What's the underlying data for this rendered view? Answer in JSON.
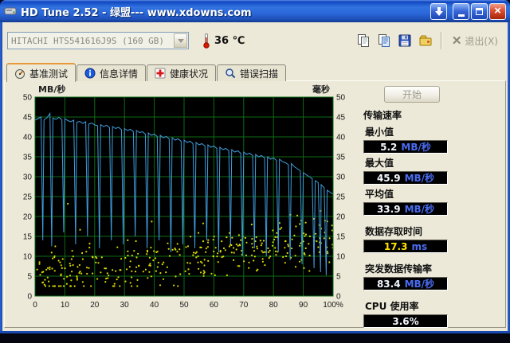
{
  "window": {
    "title": "HD Tune 2.52 - 绿盟--- www.xdowns.com"
  },
  "toolbar": {
    "drive_select": "HITACHI HTS541616J9S (160 GB)",
    "temperature": "36 ℃",
    "exit_label": "退出(X)"
  },
  "tabs": [
    {
      "label": "基准测试",
      "active": true
    },
    {
      "label": "信息详情",
      "active": false
    },
    {
      "label": "健康状况",
      "active": false
    },
    {
      "label": "错误扫描",
      "active": false
    }
  ],
  "controls": {
    "start_label": "开始"
  },
  "results": {
    "section_title": "传输速率",
    "rows": {
      "min": {
        "label": "最小值",
        "value": "5.2",
        "unit": "MB/秒"
      },
      "max": {
        "label": "最大值",
        "value": "45.9",
        "unit": "MB/秒"
      },
      "avg": {
        "label": "平均值",
        "value": "33.9",
        "unit": "MB/秒"
      },
      "access": {
        "label": "数据存取时间",
        "value": "17.3",
        "unit": "ms"
      },
      "burst": {
        "label": "突发数据传输率",
        "value": "83.4",
        "unit": "MB/秒"
      },
      "cpu": {
        "label": "CPU 使用率",
        "value": "3.6%",
        "unit": ""
      }
    }
  },
  "chart_data": {
    "type": "line",
    "title": "HD Tune benchmark: transfer rate (line) and access time (dots)",
    "x_axis": {
      "min": 0,
      "max": 100,
      "tick_step": 10,
      "unit": "%"
    },
    "left_axis": {
      "label": "MB/秒",
      "min": 0,
      "max": 50,
      "tick_step": 5
    },
    "right_axis": {
      "label": "毫秒",
      "min": 0,
      "max": 50,
      "tick_step": 5
    },
    "grid": true,
    "legend": "none",
    "colors": {
      "background": "#000000",
      "grid": "#0c6b14",
      "transfer_line": "#3f9ddd",
      "access_dots": "#e4e400",
      "tick_text": "#1a1a1a"
    },
    "series": [
      {
        "name": "transfer_rate_mb_s",
        "type": "line",
        "points": [
          [
            0,
            44.2
          ],
          [
            1,
            44.6
          ],
          [
            2,
            45.0
          ],
          [
            2.6,
            14
          ],
          [
            3,
            44.3
          ],
          [
            4,
            44.8
          ],
          [
            5,
            45.9
          ],
          [
            5.6,
            12.5
          ],
          [
            6,
            44.7
          ],
          [
            7,
            44.4
          ],
          [
            8,
            44.9
          ],
          [
            9,
            44.3
          ],
          [
            9.6,
            16
          ],
          [
            10,
            44.6
          ],
          [
            11,
            44.1
          ],
          [
            12,
            43.8
          ],
          [
            13,
            44.2
          ],
          [
            13.6,
            13
          ],
          [
            14,
            43.7
          ],
          [
            15,
            43.9
          ],
          [
            16,
            43.4
          ],
          [
            17,
            43.8
          ],
          [
            17.6,
            15
          ],
          [
            18,
            43.2
          ],
          [
            19,
            43.5
          ],
          [
            20,
            43.0
          ],
          [
            21,
            42.8
          ],
          [
            21.6,
            12
          ],
          [
            22,
            43.1
          ],
          [
            23,
            42.6
          ],
          [
            24,
            42.9
          ],
          [
            25,
            42.3
          ],
          [
            25.6,
            14
          ],
          [
            26,
            42.6
          ],
          [
            27,
            42.1
          ],
          [
            28,
            42.4
          ],
          [
            29,
            41.8
          ],
          [
            29.6,
            13
          ],
          [
            30,
            42.1
          ],
          [
            31,
            41.6
          ],
          [
            32,
            41.9
          ],
          [
            33,
            41.3
          ],
          [
            33.6,
            15
          ],
          [
            34,
            41.6
          ],
          [
            35,
            41.1
          ],
          [
            36,
            41.3
          ],
          [
            37,
            40.7
          ],
          [
            37.6,
            12
          ],
          [
            38,
            41.0
          ],
          [
            39,
            40.4
          ],
          [
            40,
            40.7
          ],
          [
            41,
            40.1
          ],
          [
            41.6,
            14
          ],
          [
            42,
            40.4
          ],
          [
            43,
            39.8
          ],
          [
            44,
            40.1
          ],
          [
            45,
            39.5
          ],
          [
            45.6,
            11
          ],
          [
            46,
            39.8
          ],
          [
            47,
            39.2
          ],
          [
            48,
            39.5
          ],
          [
            49,
            38.9
          ],
          [
            49.6,
            13
          ],
          [
            50,
            39.2
          ],
          [
            51,
            38.6
          ],
          [
            52,
            38.9
          ],
          [
            53,
            38.3
          ],
          [
            53.6,
            12
          ],
          [
            54,
            38.6
          ],
          [
            55,
            38.0
          ],
          [
            56,
            38.3
          ],
          [
            57,
            37.7
          ],
          [
            57.6,
            14
          ],
          [
            58,
            38.0
          ],
          [
            59,
            37.4
          ],
          [
            60,
            37.7
          ],
          [
            61,
            37.1
          ],
          [
            61.6,
            11
          ],
          [
            62,
            37.4
          ],
          [
            63,
            36.8
          ],
          [
            64,
            37.1
          ],
          [
            65,
            36.5
          ],
          [
            65.6,
            13
          ],
          [
            66,
            36.8
          ],
          [
            67,
            36.2
          ],
          [
            68,
            36.5
          ],
          [
            69,
            35.9
          ],
          [
            69.6,
            10
          ],
          [
            70,
            36.2
          ],
          [
            71,
            35.6
          ],
          [
            72,
            35.9
          ],
          [
            73,
            35.3
          ],
          [
            73.6,
            12
          ],
          [
            74,
            35.6
          ],
          [
            75,
            35.0
          ],
          [
            76,
            35.3
          ],
          [
            77,
            34.7
          ],
          [
            77.6,
            10
          ],
          [
            78,
            35.0
          ],
          [
            79,
            34.4
          ],
          [
            80,
            34.7
          ],
          [
            81,
            34.1
          ],
          [
            81.6,
            11
          ],
          [
            82,
            34.4
          ],
          [
            83,
            33.8
          ],
          [
            84,
            33.5
          ],
          [
            85,
            33.0
          ],
          [
            85.6,
            9
          ],
          [
            86,
            33.3
          ],
          [
            87,
            32.5
          ],
          [
            88,
            32.0
          ],
          [
            89,
            31.5
          ],
          [
            89.6,
            8
          ],
          [
            90,
            31.0
          ],
          [
            91,
            30.5
          ],
          [
            92,
            30.0
          ],
          [
            93,
            29.5
          ],
          [
            93.6,
            7
          ],
          [
            94,
            29.0
          ],
          [
            95,
            28.5
          ],
          [
            95.8,
            6
          ],
          [
            96,
            28.0
          ],
          [
            97,
            27.2
          ],
          [
            97.7,
            5.2
          ],
          [
            98,
            26.6
          ],
          [
            99,
            26.1
          ],
          [
            100,
            25.6
          ]
        ]
      },
      {
        "name": "access_time_ms",
        "type": "scatter_spec",
        "count": 360,
        "seed": 11,
        "y_base": 5,
        "y_slope": 0.09,
        "y_spread": 7.5,
        "outlier_rate": 0.05,
        "outlier_extra": 16,
        "y_min": 2.5,
        "y_max": 45
      }
    ],
    "summary": {
      "min_mb_s": 5.2,
      "max_mb_s": 45.9,
      "avg_mb_s": 33.9,
      "access_ms": 17.3,
      "burst_mb_s": 83.4,
      "cpu_pct": 3.6
    }
  }
}
